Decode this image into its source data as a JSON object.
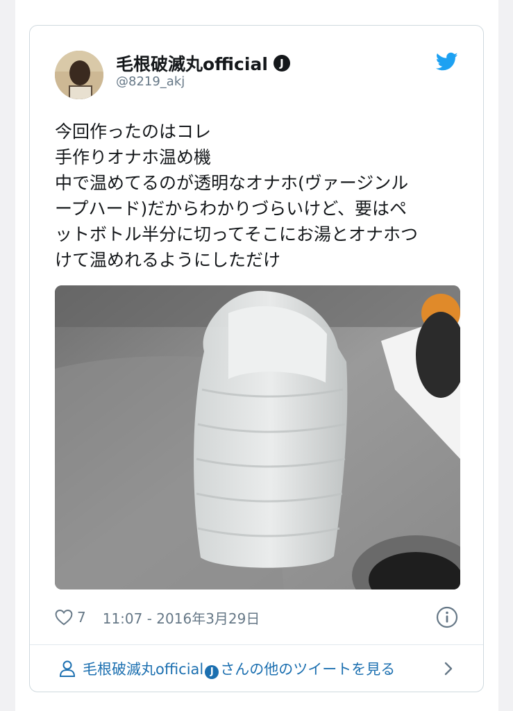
{
  "author": {
    "display_name": "毛根破滅丸official",
    "verified_badge": "J",
    "handle": "@8219_akj"
  },
  "icons": {
    "brand": "twitter-bird-icon",
    "like": "heart-icon",
    "info": "info-icon",
    "profile": "person-icon",
    "more": "chevron-right-icon"
  },
  "colors": {
    "twitter_blue": "#1da1f2",
    "link_blue": "#1b6fb0",
    "muted": "#657786",
    "border": "#cfd9de"
  },
  "tweet": {
    "lines": [
      "今回作ったのはコレ",
      "手作りオナホ温め機",
      "中で温めてるのが透明なオナホ(ヴァージンル",
      "ープハード)だからわかりづらいけど、要はペ",
      "ットボトル半分に切ってそこにお湯とオナホつ",
      "けて温めれるようにしただけ"
    ]
  },
  "footer": {
    "like_count": "7",
    "timestamp": "11:07 - 2016年3月29日"
  },
  "more_tweets": {
    "name": "毛根破滅丸official",
    "badge": "J",
    "suffix": "さんの他のツイートを見る"
  }
}
